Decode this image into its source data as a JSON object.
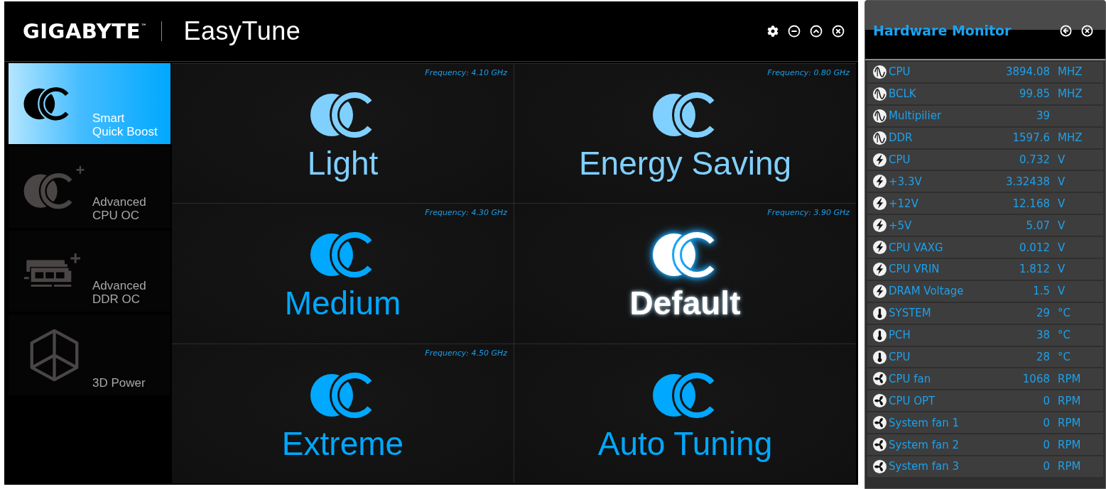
{
  "window": {
    "logo": "GIGABYTE$^{™}$",
    "title": "EasyTune"
  },
  "sidebar": {
    "items": [
      {
        "kind": "oc",
        "label_lines": [
          "Smart",
          "Quick Boost"
        ],
        "selected": true
      },
      {
        "kind": "oc-plus",
        "label_lines": [
          "Advanced",
          "CPU OC"
        ],
        "selected": false
      },
      {
        "kind": "ram-plus",
        "label_lines": [
          "Advanced",
          "DDR OC"
        ],
        "selected": false
      },
      {
        "kind": "cube",
        "label_lines": [
          "3D Power"
        ],
        "selected": false
      }
    ]
  },
  "profiles": [
    {
      "name": "Light",
      "frequency": "Frequency: 4.10 GHz",
      "color": "#80d0ff",
      "selected": false
    },
    {
      "name": "Energy Saving",
      "frequency": "Frequency: 0.80 GHz",
      "color": "#80d0ff",
      "selected": false
    },
    {
      "name": "Medium",
      "frequency": "Frequency: 4.30 GHz",
      "color": "#00a8ff",
      "selected": false
    },
    {
      "name": "Default",
      "frequency": "Frequency: 3.90 GHz",
      "selected": true
    },
    {
      "name": "Extreme",
      "frequency": "Frequency: 4.50 GHz",
      "color": "#00a8ff",
      "selected": false
    },
    {
      "name": "Auto Tuning",
      "color": "#00a8ff",
      "selected": false
    }
  ],
  "hardware_monitor": {
    "title": "Hardware Monitor",
    "rows": [
      {
        "kind": "clock",
        "label": "CPU",
        "value": "3894.08",
        "unit": "MHZ"
      },
      {
        "kind": "clock",
        "label": "BCLK",
        "value": "99.85",
        "unit": "MHZ"
      },
      {
        "kind": "clock",
        "label": "Multipilier",
        "value": "39"
      },
      {
        "kind": "clock",
        "label": "DDR",
        "value": "1597.6",
        "unit": "MHZ"
      },
      {
        "kind": "voltage",
        "label": "CPU",
        "value": "0.732",
        "unit": "V"
      },
      {
        "kind": "voltage",
        "label": "+3.3V",
        "value": "3.32438",
        "unit": "V"
      },
      {
        "kind": "voltage",
        "label": "+12V",
        "value": "12.168",
        "unit": "V"
      },
      {
        "kind": "voltage",
        "label": "+5V",
        "value": "5.07",
        "unit": "V"
      },
      {
        "kind": "voltage",
        "label": "CPU VAXG",
        "value": "0.012",
        "unit": "V"
      },
      {
        "kind": "voltage",
        "label": "CPU VRIN",
        "value": "1.812",
        "unit": "V"
      },
      {
        "kind": "voltage",
        "label": "DRAM Voltage",
        "value": "1.5",
        "unit": "V"
      },
      {
        "kind": "temperature",
        "label": "SYSTEM",
        "value": "29",
        "unit": "°C"
      },
      {
        "kind": "temperature",
        "label": "PCH",
        "value": "38",
        "unit": "°C"
      },
      {
        "kind": "temperature",
        "label": "CPU",
        "value": "28",
        "unit": "°C"
      },
      {
        "kind": "fan",
        "label": "CPU fan",
        "value": "1068",
        "unit": "RPM"
      },
      {
        "kind": "fan",
        "label": "CPU OPT",
        "value": "0",
        "unit": "RPM"
      },
      {
        "kind": "fan",
        "label": "System fan 1",
        "value": "0",
        "unit": "RPM"
      },
      {
        "kind": "fan",
        "label": "System fan 2",
        "value": "0",
        "unit": "RPM"
      },
      {
        "kind": "fan",
        "label": "System fan 3",
        "value": "0",
        "unit": "RPM"
      }
    ]
  }
}
